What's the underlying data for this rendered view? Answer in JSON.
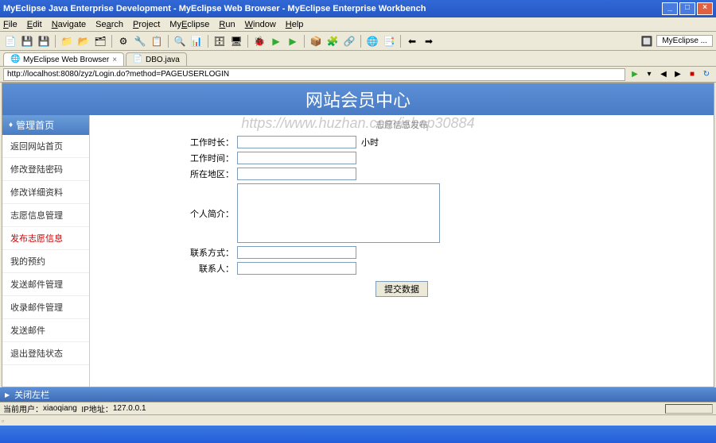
{
  "window": {
    "title": "MyEclipse Java Enterprise Development - MyEclipse Web Browser - MyEclipse Enterprise Workbench"
  },
  "menu": {
    "file": "File",
    "edit": "Edit",
    "navigate": "Navigate",
    "search": "Search",
    "project": "Project",
    "myeclipse": "MyEclipse",
    "run": "Run",
    "window": "Window",
    "help": "Help"
  },
  "perspective_label": "MyEclipse ...",
  "tabs": {
    "browser": "MyEclipse Web Browser",
    "dbo": "DBO.java"
  },
  "addressbar": {
    "url": "http://localhost:8080/zyz/Login.do?method=PAGEUSERLOGIN"
  },
  "page": {
    "title": "网站会员中心",
    "watermark": "https://www.huzhan.com/ishop30884",
    "sidebar_header": "管理首页",
    "sidebar_items": [
      "返回网站首页",
      "修改登陆密码",
      "修改详细资料",
      "志愿信息管理",
      "发布志愿信息",
      "我的预约",
      "发送邮件管理",
      "收录邮件管理",
      "发送邮件",
      "退出登陆状态"
    ],
    "form_title": "志愿信息发布",
    "form": {
      "work_len_label": "工作时长：",
      "work_len_unit": "小时",
      "work_time_label": "工作时间：",
      "area_label": "所在地区：",
      "intro_label": "个人简介：",
      "contact_label": "联系方式：",
      "person_label": "联系人：",
      "submit": "提交数据"
    }
  },
  "bottom": {
    "close_left": "关闭左栏"
  },
  "status": {
    "user_label": "当前用户：",
    "user": "xiaoqiang",
    "ip_label": "IP地址：",
    "ip": "127.0.0.1"
  }
}
